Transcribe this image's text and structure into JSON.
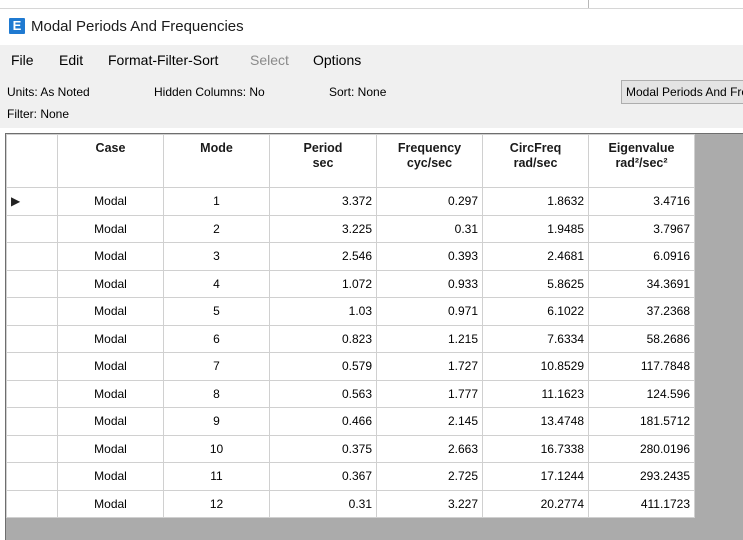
{
  "window": {
    "title": "Modal Periods And Frequencies",
    "icon_letter": "E"
  },
  "menu": [
    "File",
    "Edit",
    "Format-Filter-Sort",
    "Select",
    "Options"
  ],
  "info": {
    "units": "Units: As Noted",
    "hidden": "Hidden Columns: No",
    "sort": "Sort: None",
    "filter": "Filter: None",
    "table_selector": "Modal Periods And Frequencies"
  },
  "columns": [
    {
      "name": "Case",
      "unit": ""
    },
    {
      "name": "Mode",
      "unit": ""
    },
    {
      "name": "Period",
      "unit": "sec"
    },
    {
      "name": "Frequency",
      "unit": "cyc/sec"
    },
    {
      "name": "CircFreq",
      "unit": "rad/sec"
    },
    {
      "name": "Eigenvalue",
      "unit": "rad²/sec²"
    }
  ],
  "row_marker": "▶",
  "rows": [
    [
      "Modal",
      "1",
      "3.372",
      "0.297",
      "1.8632",
      "3.4716"
    ],
    [
      "Modal",
      "2",
      "3.225",
      "0.31",
      "1.9485",
      "3.7967"
    ],
    [
      "Modal",
      "3",
      "2.546",
      "0.393",
      "2.4681",
      "6.0916"
    ],
    [
      "Modal",
      "4",
      "1.072",
      "0.933",
      "5.8625",
      "34.3691"
    ],
    [
      "Modal",
      "5",
      "1.03",
      "0.971",
      "6.1022",
      "37.2368"
    ],
    [
      "Modal",
      "6",
      "0.823",
      "1.215",
      "7.6334",
      "58.2686"
    ],
    [
      "Modal",
      "7",
      "0.579",
      "1.727",
      "10.8529",
      "117.7848"
    ],
    [
      "Modal",
      "8",
      "0.563",
      "1.777",
      "11.1623",
      "124.596"
    ],
    [
      "Modal",
      "9",
      "0.466",
      "2.145",
      "13.4748",
      "181.5712"
    ],
    [
      "Modal",
      "10",
      "0.375",
      "2.663",
      "16.7338",
      "280.0196"
    ],
    [
      "Modal",
      "11",
      "0.367",
      "2.725",
      "17.1244",
      "293.2435"
    ],
    [
      "Modal",
      "12",
      "0.31",
      "3.227",
      "20.2774",
      "411.1723"
    ]
  ]
}
